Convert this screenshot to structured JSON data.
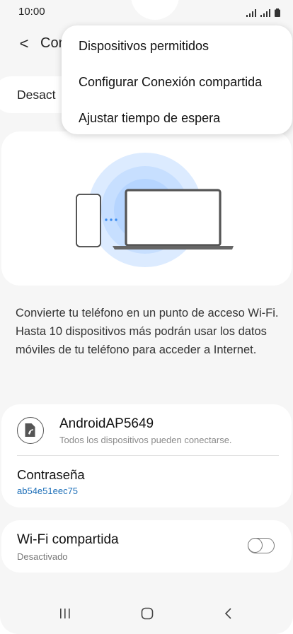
{
  "status_bar": {
    "time": "10:00"
  },
  "app_bar": {
    "back_glyph": "<",
    "title": "Con"
  },
  "hotspot_toggle_label": "Desact",
  "description": "Convierte tu teléfono en un punto de acceso Wi-Fi. Hasta 10 dispositivos más podrán usar los datos móviles de tu teléfono para acceder a Internet.",
  "network": {
    "name": "AndroidAP5649",
    "subtitle": "Todos los dispositivos pueden conectarse.",
    "password_label": "Contraseña",
    "password_value": "ab54e51eec75"
  },
  "wifi_shared": {
    "label": "Wi-Fi compartida",
    "status": "Desactivado",
    "enabled": false
  },
  "menu": {
    "items": [
      {
        "label": "Dispositivos permitidos"
      },
      {
        "label": "Configurar Conexión compartida"
      },
      {
        "label": "Ajustar tiempo de espera"
      }
    ]
  },
  "colors": {
    "accent": "#1d6fb8",
    "hero_circle": "#d6e9ff",
    "card": "#ffffff",
    "background": "#f6f6f6"
  },
  "icons": [
    "signal-icon",
    "battery-icon",
    "hotspot-icon",
    "recents-icon",
    "home-icon",
    "back-icon"
  ]
}
